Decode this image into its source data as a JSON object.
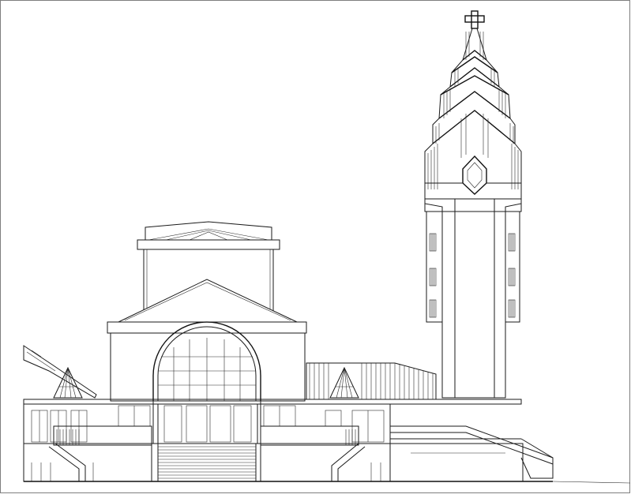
{
  "drawing": {
    "kind": "architectural elevation",
    "line_color": "#1a1a1a",
    "paper_color": "#ffffff"
  }
}
